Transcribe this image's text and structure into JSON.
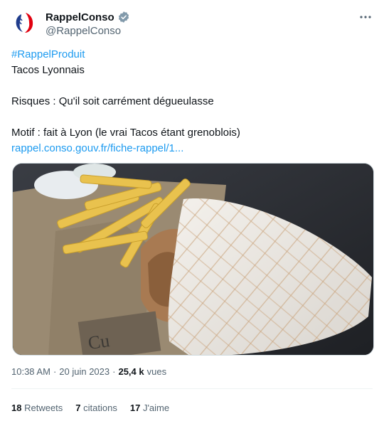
{
  "author": {
    "display_name": "RappelConso",
    "handle": "@RappelConso",
    "avatar_icon": "marianne-logo-icon",
    "verified_icon": "verified-badge-icon",
    "verified_color": "#829aab"
  },
  "menu_icon": "more-horizontal-icon",
  "tweet": {
    "hashtag": "#RappelProduit",
    "line1": "Tacos Lyonnais",
    "line2": "Risques : Qu'il soit carrément dégueulasse",
    "line3": "Motif : fait à Lyon (le vrai Tacos étant grenoblois)",
    "link": "rappel.conso.gouv.fr/fiche-rappel/1..."
  },
  "media": {
    "subject": "photo-tacos-and-fries"
  },
  "meta": {
    "time": "10:38 AM",
    "separator": "·",
    "date": "20 juin 2023",
    "views_count": "25,4 k",
    "views_label": "vues"
  },
  "stats": {
    "retweets_count": "18",
    "retweets_label": "Retweets",
    "quotes_count": "7",
    "quotes_label": "citations",
    "likes_count": "17",
    "likes_label": "J'aime"
  },
  "colors": {
    "link": "#1d9bf0",
    "secondary": "#536471",
    "primary": "#0f1419"
  }
}
